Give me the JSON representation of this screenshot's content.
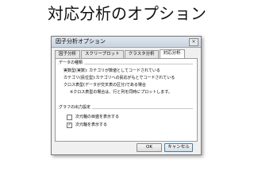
{
  "page": {
    "title": "対応分析のオプション"
  },
  "dialog": {
    "title": "因子分析オプション",
    "close_glyph": "×",
    "tabs": [
      {
        "label": "因子分析"
      },
      {
        "label": "スクリープロット"
      },
      {
        "label": "クラスタ分析"
      },
      {
        "label": "対応分析"
      }
    ],
    "active_tab": "対応分析",
    "data_group": {
      "label": "データの種類",
      "lines": [
        "実数型(実数): カテゴリが数値としてコードされている",
        "カテゴリ(民位型):カテゴリへの民応がもとでコードされている",
        "クロス表型(データが交叉表の区分)である場合",
        "※クロス表型の場合は、行と列を同時にプロットします。"
      ]
    },
    "graph_group": {
      "label": "グラフの出力設定",
      "checkboxes": [
        {
          "label": "次元軸の目盛を表示する",
          "checked": false,
          "mark": ""
        },
        {
          "label": "次元軸を表示する",
          "checked": true,
          "mark": "✓"
        }
      ]
    },
    "buttons": {
      "ok": "OK",
      "cancel": "キャンセル"
    }
  }
}
